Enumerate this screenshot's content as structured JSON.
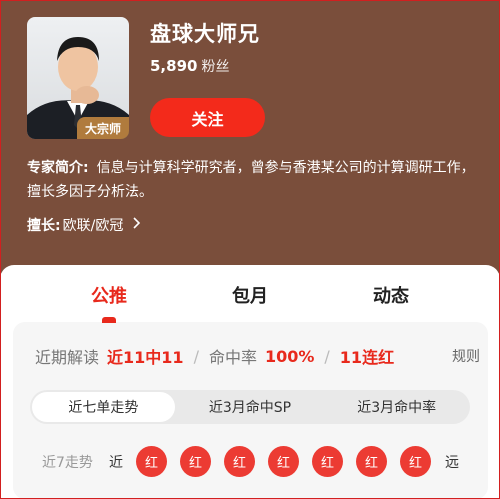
{
  "profile": {
    "name": "盘球大师兄",
    "fans_count": "5,890",
    "fans_unit": "粉丝",
    "badge": "大宗师",
    "follow_label": "关注"
  },
  "intro": {
    "label": "专家简介:",
    "text": "信息与计算科学研究者，曾参与香港某公司的计算调研工作，擅长多因子分析法。"
  },
  "skill": {
    "label": "擅长:",
    "value": "欧联/欧冠",
    "chevron_icon": "chevron-right-icon"
  },
  "tabs": [
    {
      "label": "公推",
      "active": true
    },
    {
      "label": "包月",
      "active": false
    },
    {
      "label": "动态",
      "active": false
    }
  ],
  "stats": {
    "recent_label": "近期解读",
    "recent_value": "近11中11",
    "hit_rate_label": "命中率",
    "hit_rate_value": "100%",
    "streak_value": "11连红",
    "rules_label": "规则"
  },
  "segments": [
    {
      "label": "近七单走势",
      "active": true
    },
    {
      "label": "近3月命中SP",
      "active": false
    },
    {
      "label": "近3月命中率",
      "active": false
    }
  ],
  "trend": {
    "label": "近7走势",
    "near_label": "近",
    "far_label": "远",
    "results": [
      "红",
      "红",
      "红",
      "红",
      "红",
      "红",
      "红"
    ]
  },
  "colors": {
    "header_bg": "#7a4e3b",
    "accent_red": "#e8291c",
    "badge_gold": "#b07b3d"
  }
}
